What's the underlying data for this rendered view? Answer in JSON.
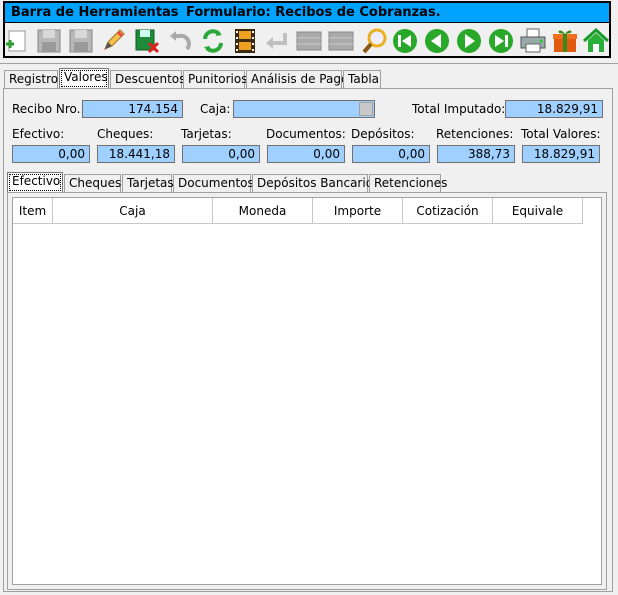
{
  "toolbar": {
    "title_left": "Barra de Herramientas",
    "title_right": "Formulario: Recibos de Cobranzas.",
    "buttons": [
      "add-icon",
      "save-icon",
      "save-as-icon",
      "edit-icon",
      "delete-record-icon",
      "undo-icon",
      "refresh-icon",
      "film-icon",
      "return-icon",
      "grid-icon",
      "grid-icon",
      "search-icon",
      "first-icon",
      "prev-icon",
      "next-icon",
      "last-icon",
      "printer-icon",
      "gift-icon",
      "home-icon"
    ]
  },
  "main_tabs": [
    "Registro",
    "Valores",
    "Descuentos",
    "Punitorios",
    "Análisis de Pago",
    "Tabla"
  ],
  "header": {
    "recibo_label": "Recibo Nro.:",
    "recibo_value": "174.154",
    "caja_label": "Caja:",
    "caja_value": "",
    "total_imputado_label": "Total Imputado:",
    "total_imputado_value": "18.829,91"
  },
  "totals": {
    "labels": [
      "Efectivo:",
      "Cheques:",
      "Tarjetas:",
      "Documentos:",
      "Depósitos:",
      "Retenciones:",
      "Total Valores:"
    ],
    "values": [
      "0,00",
      "18.441,18",
      "0,00",
      "0,00",
      "0,00",
      "388,73",
      "18.829,91"
    ]
  },
  "sub_tabs": [
    "Efectivo",
    "Cheques",
    "Tarjetas",
    "Documentos",
    "Depósitos Bancarios",
    "Retenciones"
  ],
  "grid": {
    "columns": [
      "Item",
      "Caja",
      "Moneda",
      "Importe",
      "Cotización",
      "Equivale"
    ]
  }
}
